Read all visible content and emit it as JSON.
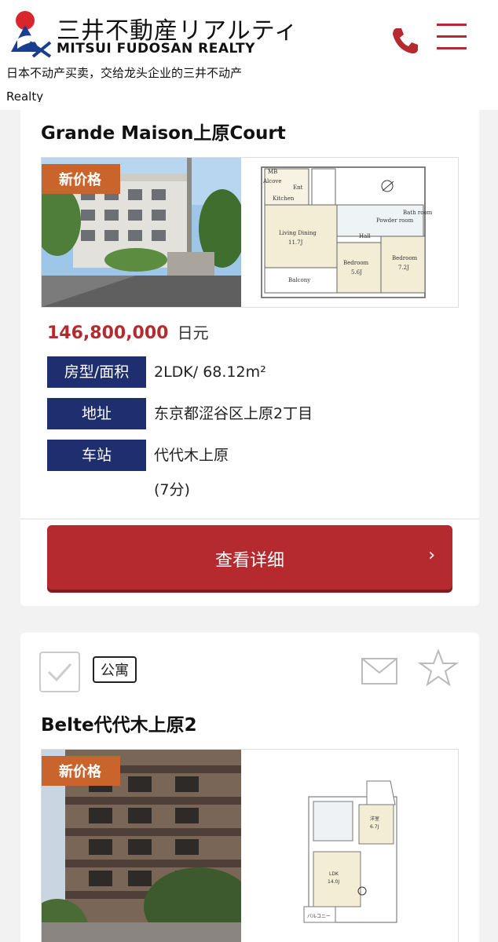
{
  "header": {
    "brand_jp": "三井不動産リアルティ",
    "brand_en": "MITSUI FUDOSAN REALTY",
    "tagline": "日本不动产买卖，交给龙头企业的三井不动产",
    "tagline2": "Realty",
    "phone_icon": "phone-icon",
    "menu_icon": "hamburger-menu-icon",
    "accent_color": "#b52a2e"
  },
  "listing1": {
    "title": "Grande Maison上原Court",
    "badge": "新价格",
    "price": "146,800,000",
    "currency": "日元",
    "rows": [
      {
        "label": "房型/面积",
        "value": "2LDK/ 68.12m²"
      },
      {
        "label": "地址",
        "value": "东京都涩谷区上原2丁目"
      },
      {
        "label": "车站",
        "value": "代代木上原"
      }
    ],
    "walk": "(7分)",
    "floorplan_labels": {
      "living": "Living Dining",
      "living_size": "11.7J",
      "balcony": "Balcony",
      "bed1": "Bedroom",
      "bed1_size": "5.6J",
      "bed2": "Bedroom",
      "bed2_size": "7.2J",
      "kitchen": "Kitchen",
      "bath": "Bath room",
      "powder": "Powder room",
      "hall": "Hall",
      "ent": "Ent",
      "mb": "MB",
      "alcove": "Alcove"
    },
    "detail_button": "查看详细",
    "chevron": "›"
  },
  "listing2": {
    "tag": "公寓",
    "title": "Belte代代木上原2",
    "badge": "新价格",
    "floorplan_labels": {
      "room": "洋室",
      "room_size": "6.7J",
      "ldk": "LDK",
      "ldk_size": "14.0J",
      "balcony": "バルコニー"
    }
  },
  "colors": {
    "navy": "#1f2e6e",
    "red": "#b52a2e",
    "badge": "#c8642c"
  }
}
